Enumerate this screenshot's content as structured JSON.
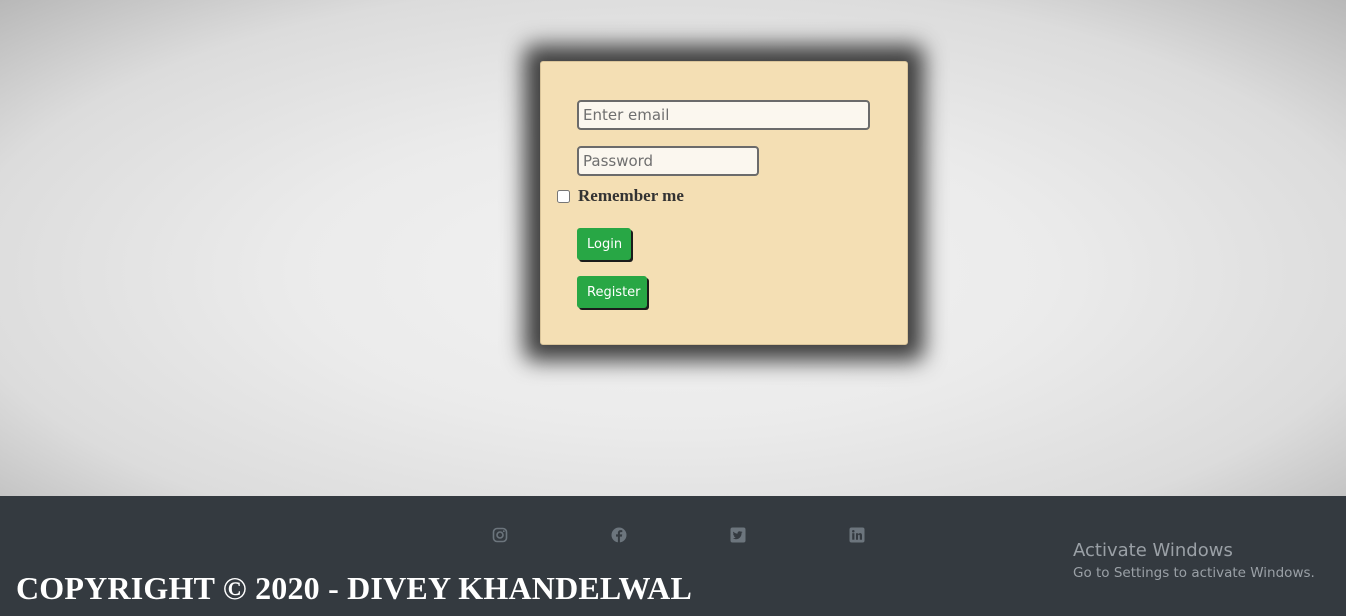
{
  "login_form": {
    "email_placeholder": "Enter email",
    "password_placeholder": "Password",
    "remember_label": "Remember me",
    "remember_checked": false,
    "login_label": "Login",
    "register_label": "Register"
  },
  "footer": {
    "social_icons": [
      "instagram-icon",
      "facebook-icon",
      "twitter-icon",
      "linkedin-icon"
    ],
    "copyright": "COPYRIGHT © 2020 - DIVEY KHANDELWAL"
  },
  "watermark": {
    "title": "Activate Windows",
    "subtitle": "Go to Settings to activate Windows."
  },
  "colors": {
    "card_background": "#f4dfb4",
    "button_green": "#28a745",
    "footer_background": "#343a40"
  }
}
